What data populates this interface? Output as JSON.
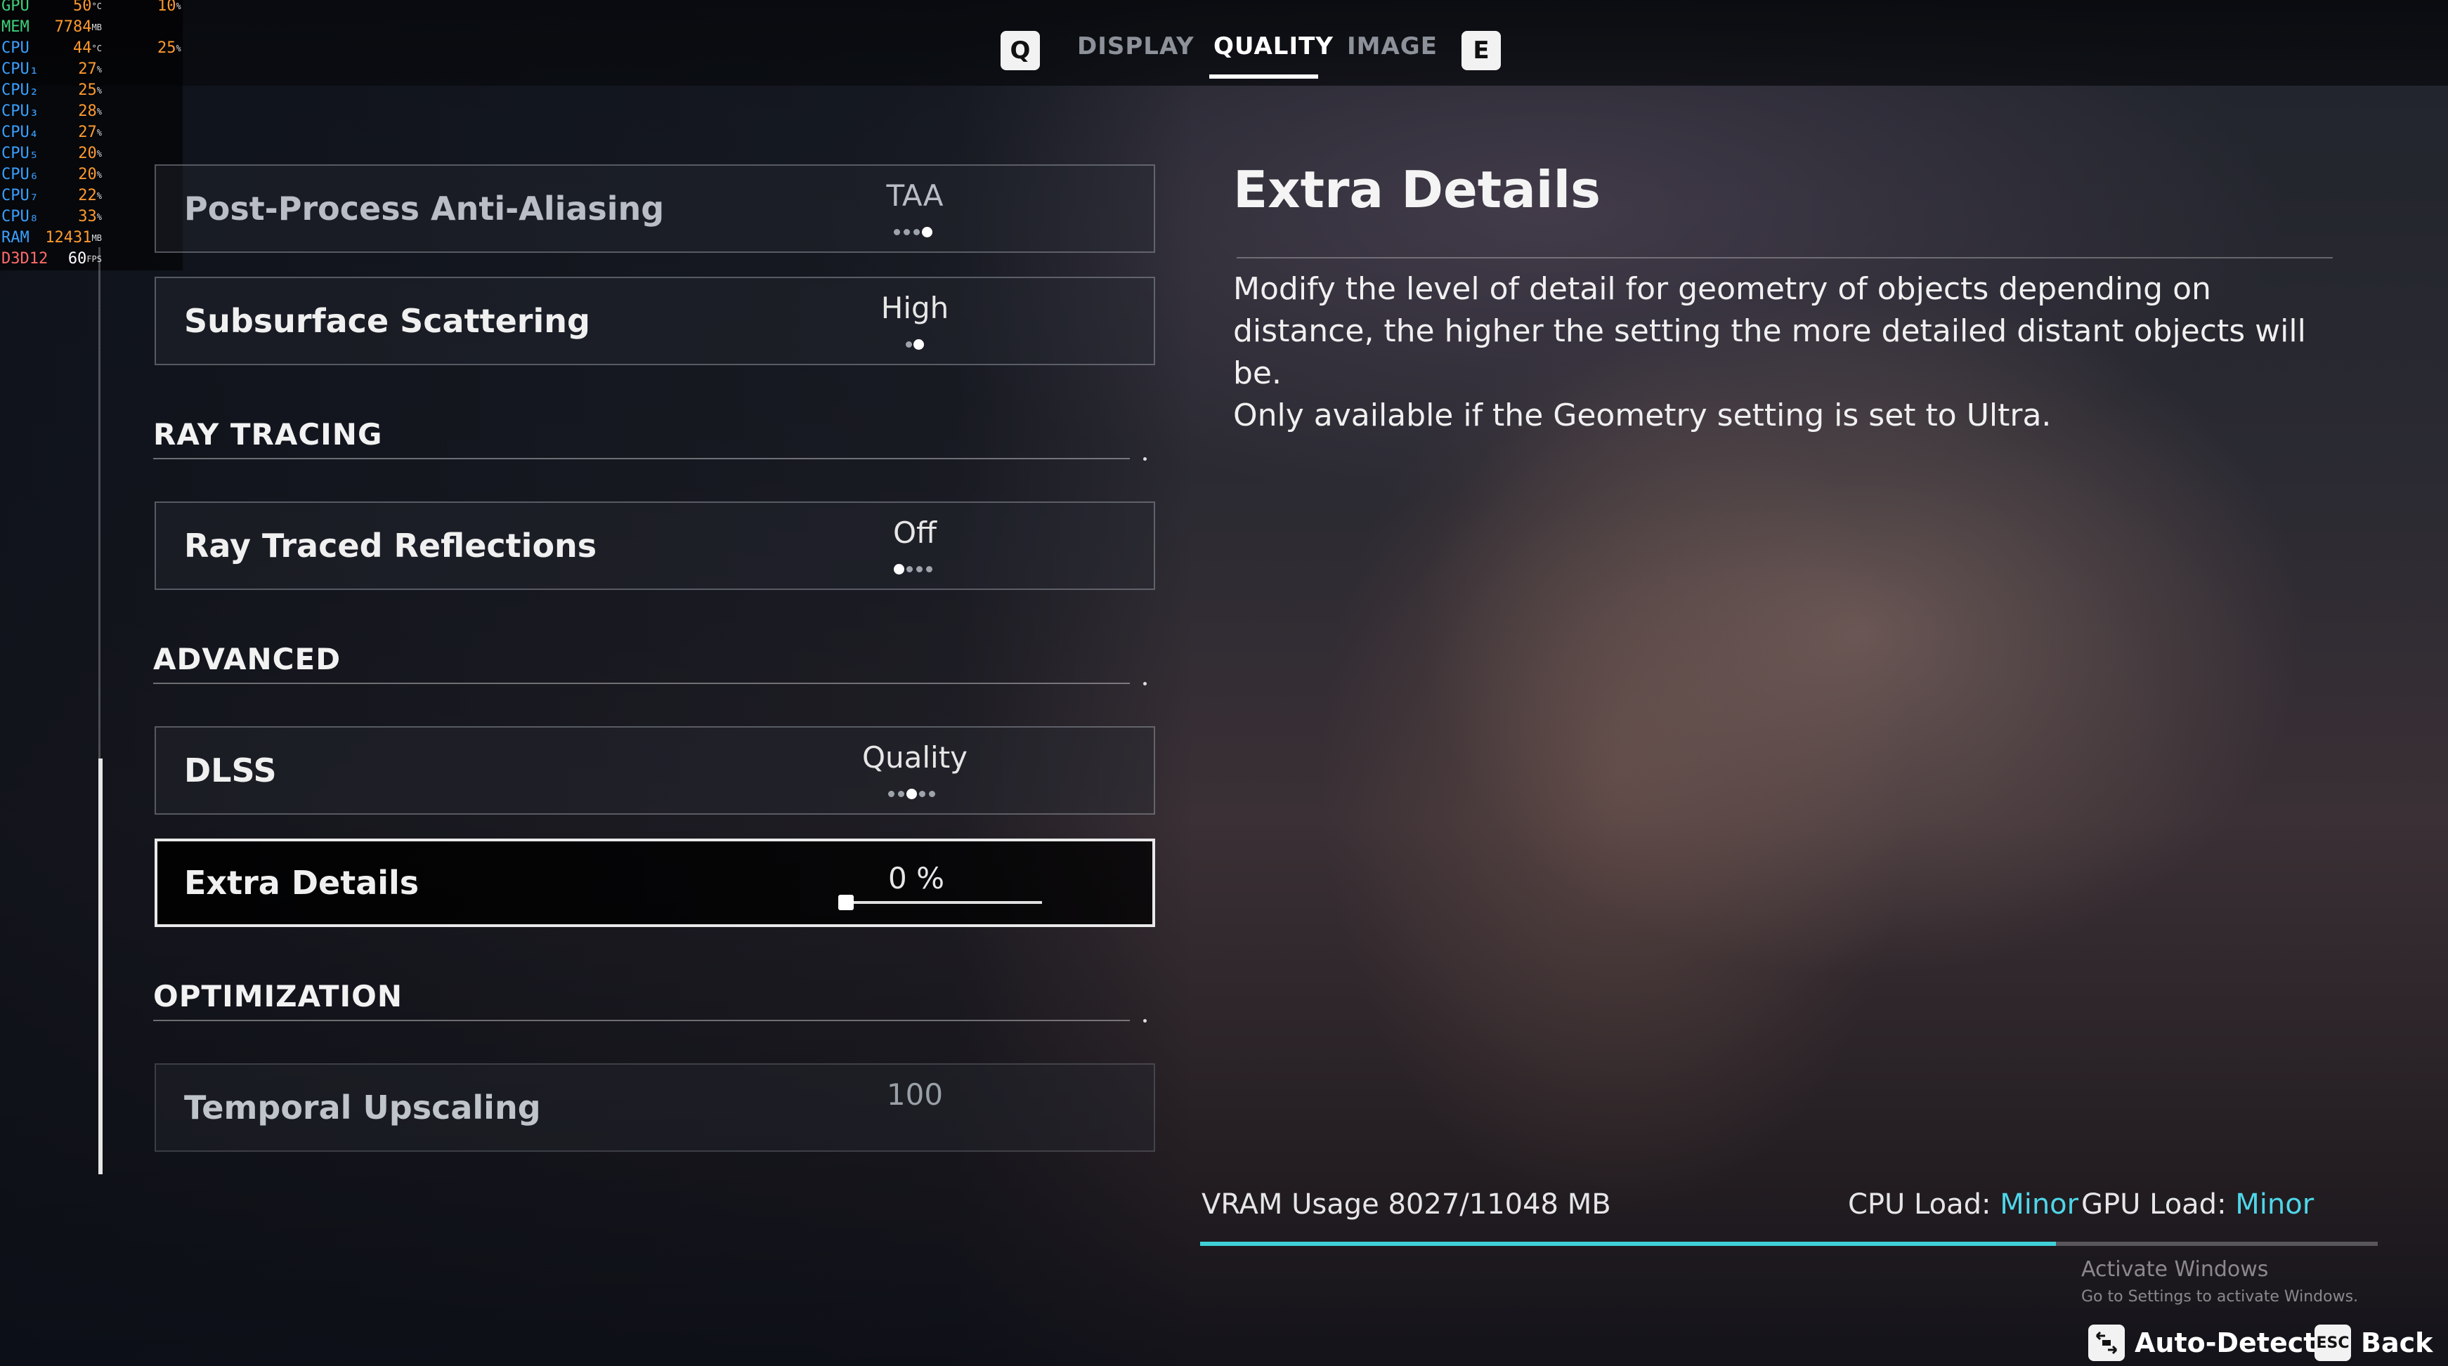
{
  "tabs": {
    "prev_key": "Q",
    "next_key": "E",
    "items": [
      {
        "label": "DISPLAY",
        "active": false
      },
      {
        "label": "QUALITY",
        "active": true
      },
      {
        "label": "IMAGE",
        "active": false
      }
    ]
  },
  "overlay": {
    "rows": [
      {
        "label": "GPU",
        "value": "50",
        "unit": "°C",
        "value2": "10",
        "unit2": "%"
      },
      {
        "label": "MEM",
        "value": "7784",
        "unit": "MB"
      },
      {
        "label": "CPU",
        "value": "44",
        "unit": "°C",
        "value2": "25",
        "unit2": "%"
      },
      {
        "label": "CPU₁",
        "value": "27",
        "unit": "%"
      },
      {
        "label": "CPU₂",
        "value": "25",
        "unit": "%"
      },
      {
        "label": "CPU₃",
        "value": "28",
        "unit": "%"
      },
      {
        "label": "CPU₄",
        "value": "27",
        "unit": "%"
      },
      {
        "label": "CPU₅",
        "value": "20",
        "unit": "%"
      },
      {
        "label": "CPU₆",
        "value": "20",
        "unit": "%"
      },
      {
        "label": "CPU₇",
        "value": "22",
        "unit": "%"
      },
      {
        "label": "CPU₈",
        "value": "33",
        "unit": "%"
      },
      {
        "label": "RAM",
        "value": "12431",
        "unit": "MB"
      },
      {
        "label": "D3D12",
        "value": "60",
        "unit": "FPS"
      }
    ]
  },
  "settings": {
    "post_process_aa": {
      "label": "Post-Process Anti-Aliasing",
      "value": "TAA"
    },
    "subsurface_scattering": {
      "label": "Subsurface Scattering",
      "value": "High"
    },
    "ray_traced_reflections": {
      "label": "Ray Traced Reflections",
      "value": "Off"
    },
    "dlss": {
      "label": "DLSS",
      "value": "Quality"
    },
    "extra_details": {
      "label": "Extra Details",
      "value": "0 %",
      "level": 0
    },
    "temporal_upscaling": {
      "label": "Temporal Upscaling",
      "value": "100"
    }
  },
  "sections": {
    "ray_tracing": "RAY TRACING",
    "advanced": "ADVANCED",
    "optimization": "OPTIMIZATION"
  },
  "detail": {
    "title": "Extra Details",
    "paragraph1": "Modify the level of detail for geometry of objects depending on distance, the higher the setting the more detailed distant objects will be.",
    "paragraph2": "Only available if the Geometry setting is set to Ultra."
  },
  "footer": {
    "vram_label": "VRAM Usage 8027/11048 MB",
    "vram_used": 8027,
    "vram_total": 11048,
    "cpu_label": "CPU Load:",
    "cpu_value": "Minor",
    "gpu_label": "GPU Load:",
    "gpu_value": "Minor",
    "auto_detect": "Auto-Detect",
    "back": "Back",
    "esc_key": "ESC"
  },
  "watermark": {
    "title": "Activate Windows",
    "subtitle": "Go to Settings to activate Windows."
  },
  "colors": {
    "accent": "#4fd6e8",
    "overlay_value": "#ff9a2e",
    "overlay_label": "#3aa0ff"
  }
}
